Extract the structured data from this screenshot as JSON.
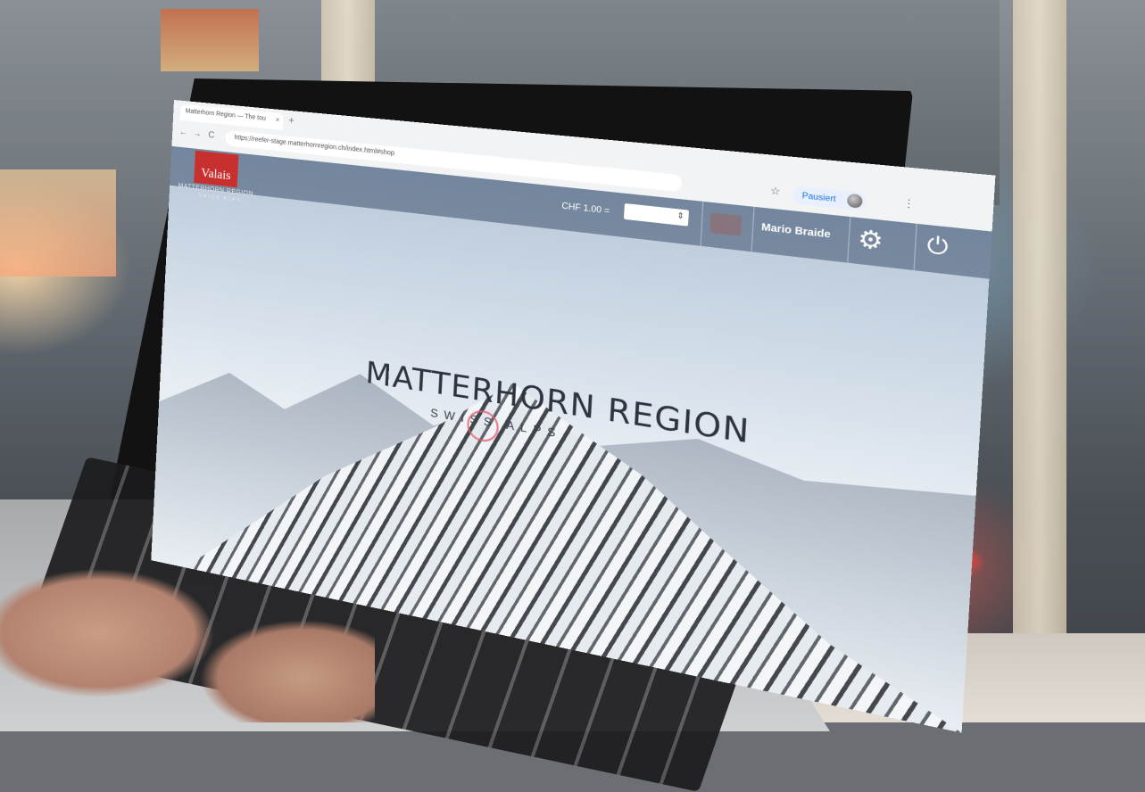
{
  "browser": {
    "tab_title": "Matterhorn Region — The tou",
    "tab_close": "×",
    "new_tab": "+",
    "address": "https://reefer-stage.matterhornregion.ch/index.html#shop",
    "star_icon": "☆",
    "paused_label": "Pausiert",
    "menu_icon": "⋮",
    "back": "←",
    "forward": "→",
    "reload": "C"
  },
  "site_header": {
    "logo_text": "Valais",
    "logo_subtitle": "MATTERHORN REGION",
    "logo_subtitle_small": "SWISS ALPS",
    "currency_label": "CHF 1.00 =",
    "currency_arrow": "⇕",
    "user_name": "Mario Braide",
    "settings_icon": "⚙",
    "power_icon": "⏻"
  },
  "hero": {
    "title": "MATTERHORN REGION",
    "subtitle": "SWISS ALPS"
  },
  "colors": {
    "logo_red": "#c8302f",
    "header_overlay": "#3c506e",
    "paused_blue": "#1a73e8"
  }
}
